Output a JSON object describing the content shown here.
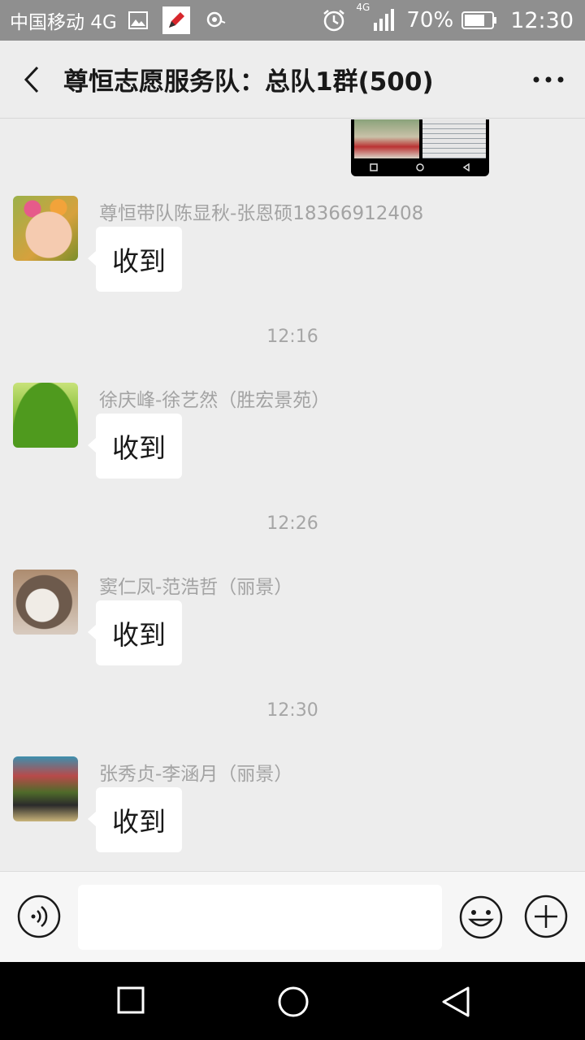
{
  "status_bar": {
    "carrier": "中国移动 4G",
    "network_tag": "4G",
    "battery_percent": "70%",
    "time": "12:30",
    "icons": [
      "image-icon",
      "pencil-app-icon",
      "location-icon",
      "alarm-icon",
      "signal-icon",
      "battery-icon"
    ]
  },
  "header": {
    "title": "尊恒志愿服务队：总队1群(500)",
    "back_icon": "back-arrow-icon",
    "more_icon": "more-dots-icon"
  },
  "chat": {
    "messages": [
      {
        "time": "",
        "sender": "尊恒带队陈显秋-张恩硕18366912408",
        "text": "收到",
        "avatar": "girl-flower-avatar"
      },
      {
        "time": "12:16",
        "sender": "徐庆峰-徐艺然（胜宏景苑）",
        "text": "收到",
        "avatar": "moss-avatar"
      },
      {
        "time": "12:26",
        "sender": "窦仁凤-范浩哲（丽景）",
        "text": "收到",
        "avatar": "cat-avatar"
      },
      {
        "time": "12:30",
        "sender": "张秀贞-李涵月（丽景）",
        "text": "收到",
        "avatar": "market-avatar"
      }
    ]
  },
  "input_bar": {
    "placeholder": "",
    "voice_icon": "voice-icon",
    "emoji_icon": "emoji-icon",
    "plus_icon": "plus-icon"
  },
  "nav_bar": {
    "icons": [
      "recent-apps-icon",
      "home-icon",
      "back-icon"
    ]
  },
  "colors": {
    "status_bar_bg": "#8f8f8f",
    "chat_bg": "#ededed",
    "bubble_bg": "#ffffff",
    "nav_bg": "#000000"
  }
}
